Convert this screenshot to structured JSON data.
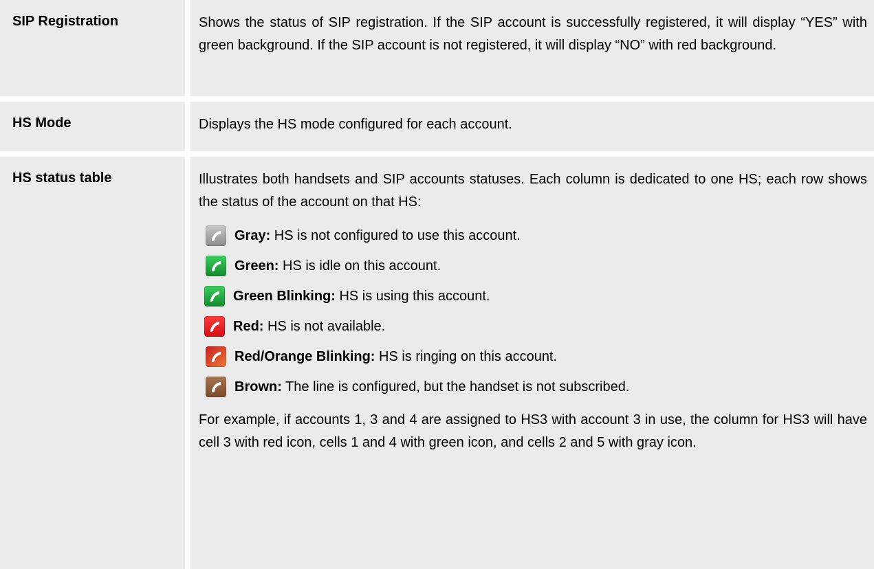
{
  "rows": [
    {
      "label": "SIP Registration",
      "description": "Shows the status of SIP registration. If the SIP account is successfully registered, it will display “YES” with green background. If the SIP account is not registered, it will display “NO” with red background."
    },
    {
      "label": "HS Mode",
      "description": "Displays the HS mode configured for each account."
    },
    {
      "label": "HS status table",
      "intro": "Illustrates both handsets and SIP accounts statuses. Each column is dedicated to one HS; each row shows the status of the account on that HS:",
      "statuses": [
        {
          "icon": "gray-phone-icon",
          "color": "#9a9a9a",
          "name": "Gray:",
          "desc": " HS is not configured to use this account."
        },
        {
          "icon": "green-phone-icon",
          "color": "#1aa23a",
          "name": "Green:",
          "desc": " HS is idle on this account."
        },
        {
          "icon": "green-blinking-phone-icon",
          "color": "#1aa23a",
          "name": "Green Blinking:",
          "desc": " HS is using this account."
        },
        {
          "icon": "red-phone-icon",
          "color": "#e8161e",
          "name": "Red:",
          "desc": " HS is not available."
        },
        {
          "icon": "red-orange-phone-icon",
          "color": "#e0502a",
          "name": "Red/Orange Blinking:",
          "desc": " HS is ringing on this account."
        },
        {
          "icon": "brown-phone-icon",
          "color": "#8a5a3a",
          "name": "Brown:",
          "desc": " The line is configured, but the handset is not subscribed."
        }
      ],
      "example": "For example, if accounts 1, 3 and 4 are assigned to HS3 with account 3 in use, the column for HS3 will have cell 3 with red icon, cells 1 and 4 with green icon, and cells 2 and 5 with gray icon."
    }
  ]
}
